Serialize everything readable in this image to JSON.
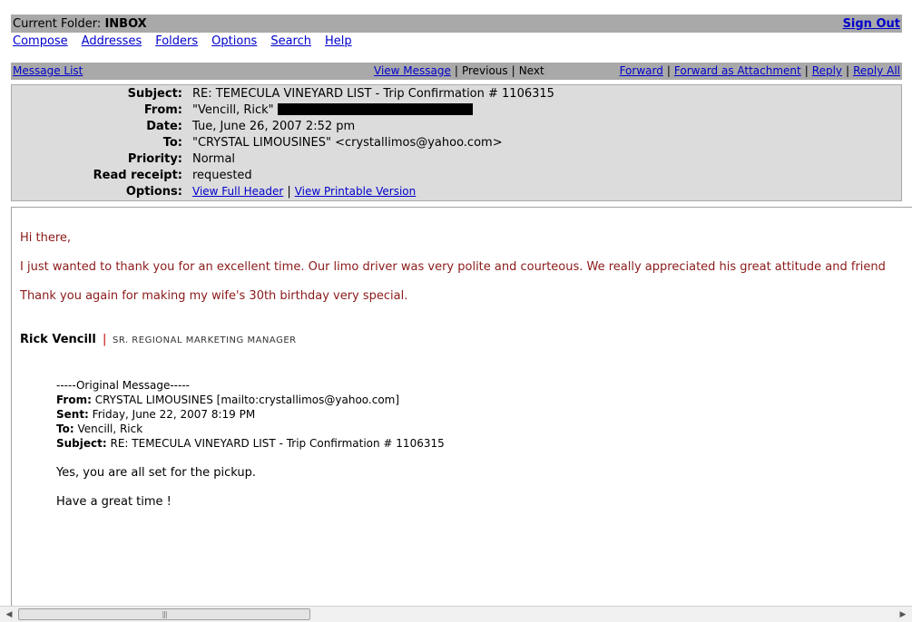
{
  "folder_bar": {
    "label": "Current Folder:",
    "folder": "INBOX",
    "sign_out": "Sign Out"
  },
  "main_nav": [
    "Compose",
    "Addresses",
    "Folders",
    "Options",
    "Search",
    "Help"
  ],
  "toolbar": {
    "message_list": "Message List",
    "view_message": "View Message",
    "previous": "Previous",
    "next": "Next",
    "forward": "Forward",
    "forward_attachment": "Forward as Attachment",
    "reply": "Reply",
    "reply_all": "Reply All"
  },
  "header": {
    "subject_label": "Subject:",
    "subject": "RE: TEMECULA VINEYARD LIST - Trip Confirmation # 1106315",
    "from_label": "From:",
    "from": "\"Vencill, Rick\"",
    "date_label": "Date:",
    "date": "Tue, June 26, 2007 2:52 pm",
    "to_label": "To:",
    "to": "\"CRYSTAL LIMOUSINES\" <crystallimos@yahoo.com>",
    "priority_label": "Priority:",
    "priority": "Normal",
    "receipt_label": "Read receipt:",
    "receipt": "requested",
    "options_label": "Options:",
    "view_full_header": "View Full Header",
    "view_printable": "View Printable Version"
  },
  "body": {
    "greeting": "Hi there,",
    "para1": "I just wanted to thank you for an excellent time.  Our limo driver was very polite and courteous.  We really appreciated his great attitude and friend",
    "para2": "Thank you again for making my wife's 30th birthday very special.",
    "sig_name": "Rick Vencill",
    "sig_sep": "|",
    "sig_title": "SR. REGIONAL MARKETING MANAGER",
    "orig_header": "-----Original Message-----",
    "orig_from_label": "From:",
    "orig_from": " CRYSTAL LIMOUSINES [mailto:crystallimos@yahoo.com]",
    "orig_sent_label": "Sent:",
    "orig_sent": " Friday, June 22, 2007 8:19 PM",
    "orig_to_label": "To:",
    "orig_to": " Vencill, Rick",
    "orig_subject_label": "Subject:",
    "orig_subject": " RE: TEMECULA VINEYARD LIST - Trip Confirmation # 1106315",
    "orig_line1": "Yes, you are all set for the pickup.",
    "orig_line2": "Have a great time !"
  },
  "scrollbar": {
    "left_arrow": "◀",
    "right_arrow": "▶",
    "grip": "|||"
  }
}
